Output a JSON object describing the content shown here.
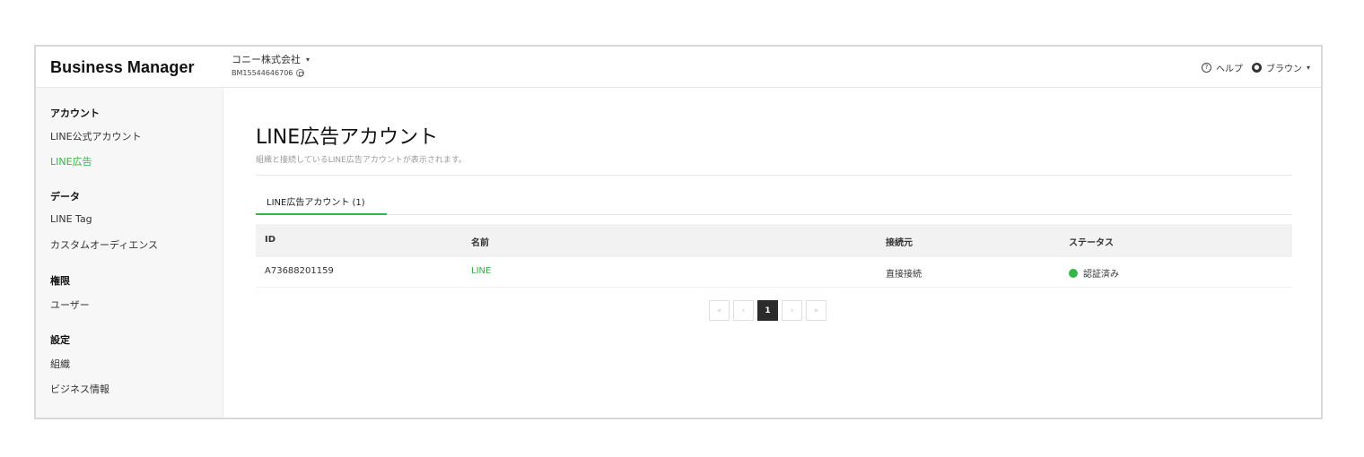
{
  "header": {
    "logo": "Business Manager",
    "org_name": "コニー株式会社",
    "org_caret": "▾",
    "org_id": "BM15544646706",
    "help_label": "ヘルプ",
    "user_name": "ブラウン",
    "user_caret": "▾"
  },
  "sidebar": {
    "sections": [
      {
        "title": "アカウント",
        "items": [
          "LINE公式アカウント",
          "LINE広告"
        ]
      },
      {
        "title": "データ",
        "items": [
          "LINE Tag",
          "カスタムオーディエンス"
        ]
      },
      {
        "title": "権限",
        "items": [
          "ユーザー"
        ]
      },
      {
        "title": "設定",
        "items": [
          "組織",
          "ビジネス情報"
        ]
      }
    ],
    "active_item": "LINE広告"
  },
  "main": {
    "title": "LINE広告アカウント",
    "description": "組織と接続しているLINE広告アカウントが表示されます。",
    "tab_label": "LINE広告アカウント (1)",
    "table": {
      "columns": [
        "ID",
        "名前",
        "接続元",
        "ステータス"
      ],
      "rows": [
        {
          "id": "A73688201159",
          "name": "LINE",
          "source": "直接接続",
          "status": "認証済み"
        }
      ]
    },
    "pagination": {
      "first": "«",
      "prev": "‹",
      "current": "1",
      "next": "›",
      "last": "»"
    }
  },
  "colors": {
    "accent": "#35b546",
    "pager_active": "#2b2b2b"
  }
}
